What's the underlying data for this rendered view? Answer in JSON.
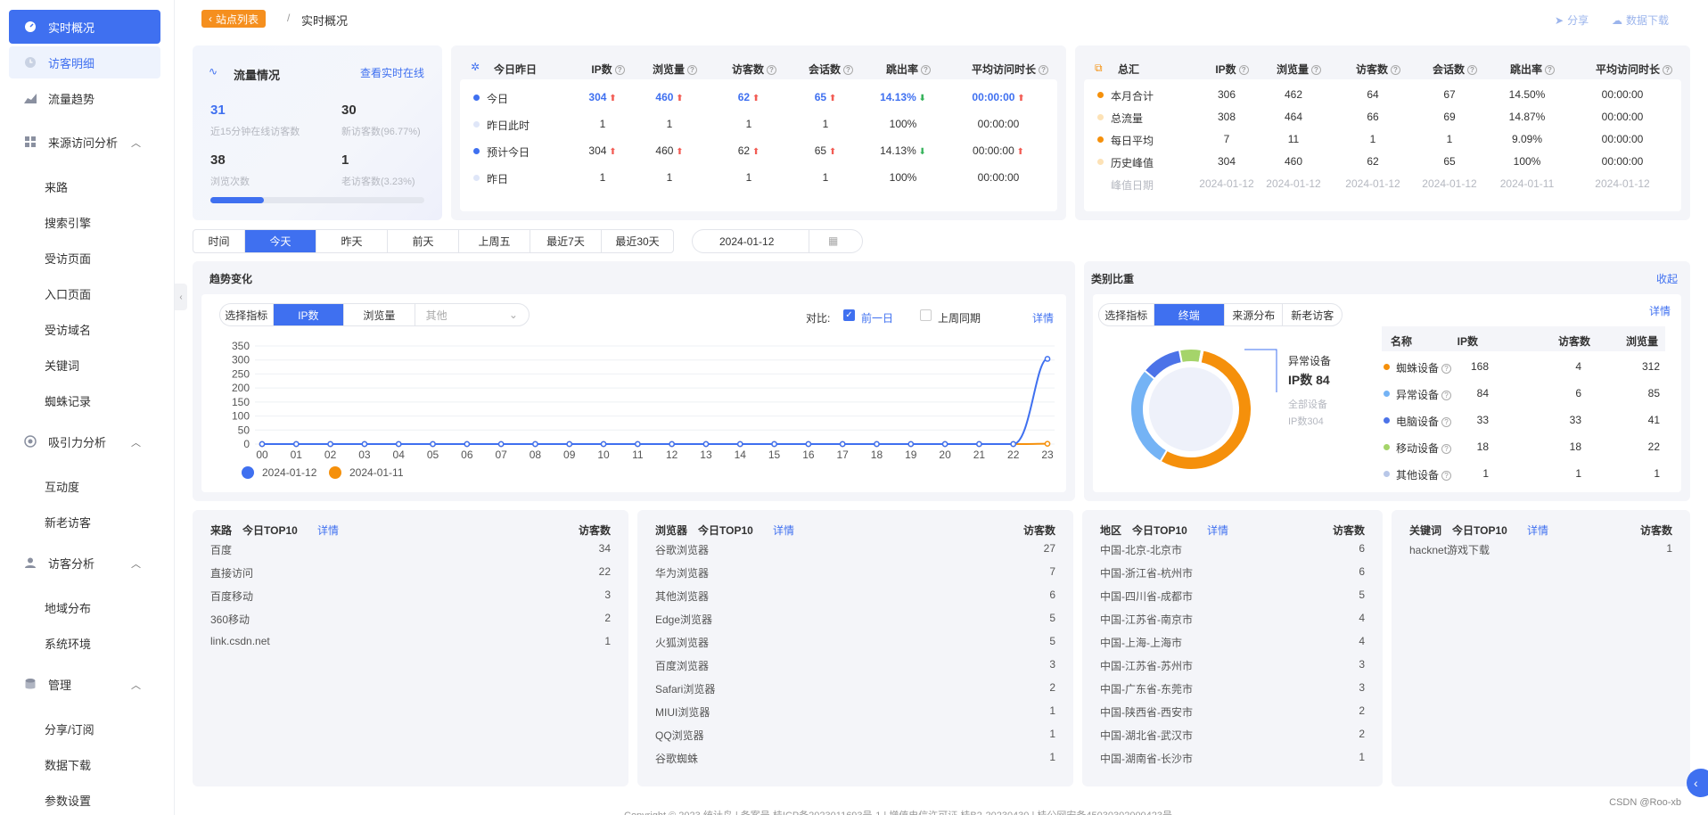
{
  "sidebar": {
    "items": [
      {
        "label": "实时概况",
        "icon": "gauge-icon"
      },
      {
        "label": "访客明细",
        "icon": "clock-icon"
      },
      {
        "label": "流量趋势",
        "icon": "area-chart-icon"
      },
      {
        "label": "来源访问分析",
        "icon": "grid-icon"
      },
      {
        "label": "吸引力分析",
        "icon": "target-icon"
      },
      {
        "label": "访客分析",
        "icon": "user-icon"
      },
      {
        "label": "管理",
        "icon": "database-icon"
      }
    ],
    "sub_source": [
      "来路",
      "搜索引擎",
      "受访页面",
      "入口页面",
      "受访域名",
      "关键词",
      "蜘蛛记录"
    ],
    "sub_attract": [
      "互动度",
      "新老访客"
    ],
    "sub_visitor": [
      "地域分布",
      "系统环境"
    ],
    "sub_manage": [
      "分享/订阅",
      "数据下载",
      "参数设置"
    ]
  },
  "topbar": {
    "back": "站点列表",
    "sep": "/",
    "title": "实时概况",
    "share": "分享",
    "download": "数据下载"
  },
  "traffic": {
    "title": "流量情况",
    "link": "查看实时在线",
    "a_num": "31",
    "a_label": "近15分钟在线访客数",
    "b_num": "30",
    "b_label": "新访客数(96.77%)",
    "c_num": "38",
    "c_label": "浏览次数",
    "d_num": "1",
    "d_label": "老访客数(3.23%)",
    "progress": 0.25
  },
  "today": {
    "title": "今日昨日",
    "headers": [
      "IP数",
      "浏览量",
      "访客数",
      "会话数",
      "跳出率",
      "平均访问时长"
    ],
    "rows": [
      {
        "name": "今日",
        "vals": [
          "304",
          "460",
          "62",
          "65",
          "14.13%",
          "00:00:00"
        ],
        "arrows": [
          "up",
          "up",
          "up",
          "up",
          "down",
          "up"
        ],
        "hl": true
      },
      {
        "name": "昨日此时",
        "vals": [
          "1",
          "1",
          "1",
          "1",
          "100%",
          "00:00:00"
        ],
        "arrows": [
          "",
          "",
          "",
          "",
          "",
          ""
        ],
        "hl": false
      },
      {
        "name": "预计今日",
        "vals": [
          "304",
          "460",
          "62",
          "65",
          "14.13%",
          "00:00:00"
        ],
        "arrows": [
          "up",
          "up",
          "up",
          "up",
          "down",
          "up"
        ],
        "hl": false
      },
      {
        "name": "昨日",
        "vals": [
          "1",
          "1",
          "1",
          "1",
          "100%",
          "00:00:00"
        ],
        "arrows": [
          "",
          "",
          "",
          "",
          "",
          ""
        ],
        "hl": false
      }
    ]
  },
  "summary": {
    "title": "总汇",
    "headers": [
      "IP数",
      "浏览量",
      "访客数",
      "会话数",
      "跳出率",
      "平均访问时长"
    ],
    "rows": [
      {
        "name": "本月合计",
        "vals": [
          "306",
          "462",
          "64",
          "67",
          "14.50%",
          "00:00:00"
        ]
      },
      {
        "name": "总流量",
        "vals": [
          "308",
          "464",
          "66",
          "69",
          "14.87%",
          "00:00:00"
        ]
      },
      {
        "name": "每日平均",
        "vals": [
          "7",
          "11",
          "1",
          "1",
          "9.09%",
          "00:00:00"
        ]
      },
      {
        "name": "历史峰值",
        "vals": [
          "304",
          "460",
          "62",
          "65",
          "100%",
          "00:00:00"
        ]
      }
    ],
    "peak_label": "峰值日期",
    "peak_dates": [
      "2024-01-12",
      "2024-01-12",
      "2024-01-12",
      "2024-01-12",
      "2024-01-11",
      "2024-01-12"
    ]
  },
  "time_tabs": [
    "时间",
    "今天",
    "昨天",
    "前天",
    "上周五",
    "最近7天",
    "最近30天"
  ],
  "date_value": "2024-01-12",
  "trend": {
    "title": "趋势变化",
    "select_label": "选择指标",
    "tabs": [
      "IP数",
      "浏览量"
    ],
    "other": "其他",
    "compare_label": "对比:",
    "opt1": "前一日",
    "opt2": "上周同期",
    "detail": "详情",
    "legend": [
      "2024-01-12",
      "2024-01-11"
    ]
  },
  "chart_data": {
    "type": "line",
    "x": [
      "00",
      "01",
      "02",
      "03",
      "04",
      "05",
      "06",
      "07",
      "08",
      "09",
      "10",
      "11",
      "12",
      "13",
      "14",
      "15",
      "16",
      "17",
      "18",
      "19",
      "20",
      "21",
      "22",
      "23"
    ],
    "series": [
      {
        "name": "2024-01-12",
        "values": [
          0,
          0,
          0,
          0,
          0,
          0,
          0,
          0,
          0,
          0,
          0,
          0,
          0,
          0,
          0,
          0,
          0,
          0,
          0,
          0,
          0,
          0,
          0,
          304
        ],
        "color": "#3f70f0"
      },
      {
        "name": "2024-01-11",
        "values": [
          0,
          0,
          0,
          0,
          0,
          0,
          0,
          0,
          0,
          0,
          0,
          0,
          0,
          0,
          0,
          0,
          0,
          0,
          0,
          0,
          0,
          0,
          0,
          1
        ],
        "color": "#f5900b"
      }
    ],
    "ylim": [
      0,
      350
    ],
    "yticks": [
      "350",
      "300",
      "250",
      "200",
      "150",
      "100",
      "50",
      "0"
    ]
  },
  "category": {
    "title": "类别比重",
    "collapse": "收起",
    "select_label": "选择指标",
    "tabs": [
      "终端",
      "来源分布",
      "新老访客"
    ],
    "detail": "详情",
    "callout_name": "异常设备",
    "callout_value": "IP数 84",
    "total_label": "全部设备",
    "total_value": "IP数304",
    "headers": [
      "名称",
      "IP数",
      "访客数",
      "浏览量"
    ],
    "rows": [
      {
        "name": "蜘蛛设备",
        "ip": "168",
        "visitors": "4",
        "pv": "312",
        "color": "#f5900b"
      },
      {
        "name": "异常设备",
        "ip": "84",
        "visitors": "6",
        "pv": "85",
        "color": "#74b3f5"
      },
      {
        "name": "电脑设备",
        "ip": "33",
        "visitors": "33",
        "pv": "41",
        "color": "#4c73e8"
      },
      {
        "name": "移动设备",
        "ip": "18",
        "visitors": "18",
        "pv": "22",
        "color": "#a5d46a"
      },
      {
        "name": "其他设备",
        "ip": "1",
        "visitors": "1",
        "pv": "1",
        "color": "#b8c7e8"
      }
    ]
  },
  "top_source": {
    "title": "来路",
    "sub": "今日TOP10",
    "detail": "详情",
    "col": "访客数",
    "rows": [
      [
        "百度",
        "34"
      ],
      [
        "直接访问",
        "22"
      ],
      [
        "百度移动",
        "3"
      ],
      [
        "360移动",
        "2"
      ],
      [
        "link.csdn.net",
        "1"
      ]
    ]
  },
  "top_browser": {
    "title": "浏览器",
    "sub": "今日TOP10",
    "detail": "详情",
    "col": "访客数",
    "rows": [
      [
        "谷歌浏览器",
        "27"
      ],
      [
        "华为浏览器",
        "7"
      ],
      [
        "其他浏览器",
        "6"
      ],
      [
        "Edge浏览器",
        "5"
      ],
      [
        "火狐浏览器",
        "5"
      ],
      [
        "百度浏览器",
        "3"
      ],
      [
        "Safari浏览器",
        "2"
      ],
      [
        "MIUI浏览器",
        "1"
      ],
      [
        "QQ浏览器",
        "1"
      ],
      [
        "谷歌蜘蛛",
        "1"
      ]
    ]
  },
  "top_region": {
    "title": "地区",
    "sub": "今日TOP10",
    "detail": "详情",
    "col": "访客数",
    "rows": [
      [
        "中国-北京-北京市",
        "6"
      ],
      [
        "中国-浙江省-杭州市",
        "6"
      ],
      [
        "中国-四川省-成都市",
        "5"
      ],
      [
        "中国-江苏省-南京市",
        "4"
      ],
      [
        "中国-上海-上海市",
        "4"
      ],
      [
        "中国-江苏省-苏州市",
        "3"
      ],
      [
        "中国-广东省-东莞市",
        "3"
      ],
      [
        "中国-陕西省-西安市",
        "2"
      ],
      [
        "中国-湖北省-武汉市",
        "2"
      ],
      [
        "中国-湖南省-长沙市",
        "1"
      ]
    ]
  },
  "top_keyword": {
    "title": "关键词",
    "sub": "今日TOP10",
    "detail": "详情",
    "col": "访客数",
    "rows": [
      [
        "hacknet游戏下载",
        "1"
      ]
    ]
  },
  "footer": "Copyright © 2023 统计鸟 | 备案号 桂ICP备2023011693号-1 | 增值电信许可证 桂B2-20230430 | 桂公网安备45030302000423号",
  "watermark": "CSDN @Roo-xb"
}
